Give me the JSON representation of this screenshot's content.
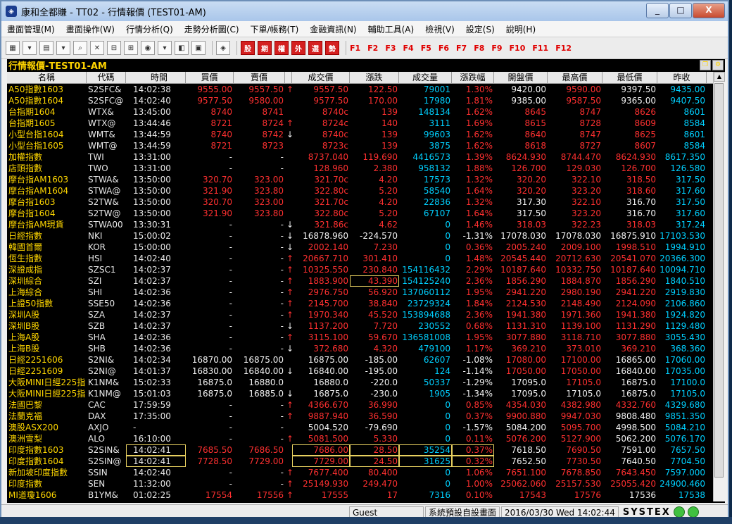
{
  "window": {
    "title": "康和全都賺 - TT02 - 行情報價 (TEST01-AM)",
    "min": "_",
    "max": "□",
    "close": "X"
  },
  "menu": [
    "畫面管理(M)",
    "畫面操作(W)",
    "行情分析(Q)",
    "走勢分析圖(C)",
    "下單/帳務(T)",
    "金融資訊(N)",
    "輔助工具(A)",
    "檢視(V)",
    "設定(S)",
    "說明(H)"
  ],
  "toolbar": {
    "redbuttons": [
      "股",
      "期",
      "權",
      "外",
      "選",
      "勢"
    ],
    "fkeys": [
      "F1",
      "F2",
      "F3",
      "F4",
      "F5",
      "F6",
      "F7",
      "F8",
      "F9",
      "F10",
      "F11",
      "F12"
    ]
  },
  "panel": {
    "title": "行情報價-TEST01-AM"
  },
  "columns": [
    "名稱",
    "代碼",
    "時間",
    "買價",
    "賣價",
    "",
    "成交價",
    "漲跌",
    "成交量",
    "漲跌幅",
    "開盤價",
    "最高價",
    "最低價",
    "昨收"
  ],
  "rows": [
    [
      "A50指數1603",
      "S2SFC&",
      "14:02:38",
      "9555.00",
      "9557.50",
      "↑",
      "9557.50",
      "122.50",
      "79001",
      "1.30%",
      "9420.00",
      "9590.00",
      "9397.50",
      "9435.00"
    ],
    [
      "A50指數1604",
      "S2SFC@",
      "14:02:40",
      "9577.50",
      "9580.00",
      "",
      "9577.50",
      "170.00",
      "17980",
      "1.81%",
      "9385.00",
      "9587.50",
      "9365.00",
      "9407.50"
    ],
    [
      "台指期1604",
      "WTX&",
      "13:45:00",
      "8740",
      "8741",
      "",
      "8740c",
      "139",
      "148134",
      "1.62%",
      "8645",
      "8747",
      "8626",
      "8601"
    ],
    [
      "台指期1605",
      "WTX@",
      "13:44:46",
      "8721",
      "8724",
      "↑",
      "8724c",
      "140",
      "3111",
      "1.69%",
      "8615",
      "8728",
      "8609",
      "8584"
    ],
    [
      "小型台指1604",
      "WMT&",
      "13:44:59",
      "8740",
      "8742",
      "↓",
      "8740c",
      "139",
      "99603",
      "1.62%",
      "8640",
      "8747",
      "8625",
      "8601"
    ],
    [
      "小型台指1605",
      "WMT@",
      "13:44:59",
      "8721",
      "8723",
      "",
      "8723c",
      "139",
      "3875",
      "1.62%",
      "8618",
      "8727",
      "8607",
      "8584"
    ],
    [
      "加權指數",
      "TWI",
      "13:31:00",
      "-",
      "-",
      "",
      "8737.040",
      "119.690",
      "4416573",
      "1.39%",
      "8624.930",
      "8744.470",
      "8624.930",
      "8617.350"
    ],
    [
      "店頭指數",
      "TWO",
      "13:31:00",
      "-",
      "-",
      "",
      "128.960",
      "2.380",
      "958132",
      "1.88%",
      "126.700",
      "129.030",
      "126.700",
      "126.580"
    ],
    [
      "摩台指AM1603",
      "STWA&",
      "13:50:00",
      "320.70",
      "323.00",
      "",
      "321.70c",
      "4.20",
      "17573",
      "1.32%",
      "320.20",
      "322.10",
      "318.50",
      "317.50"
    ],
    [
      "摩台指AM1604",
      "STWA@",
      "13:50:00",
      "321.90",
      "323.80",
      "",
      "322.80c",
      "5.20",
      "58540",
      "1.64%",
      "320.20",
      "323.20",
      "318.60",
      "317.60"
    ],
    [
      "摩台指1603",
      "S2TW&",
      "13:50:00",
      "320.70",
      "323.00",
      "",
      "321.70c",
      "4.20",
      "22836",
      "1.32%",
      "317.30",
      "322.10",
      "316.70",
      "317.50"
    ],
    [
      "摩台指1604",
      "S2TW@",
      "13:50:00",
      "321.90",
      "323.80",
      "",
      "322.80c",
      "5.20",
      "67107",
      "1.64%",
      "317.50",
      "323.20",
      "316.70",
      "317.60"
    ],
    [
      "摩台指AM現貨",
      "STWA00",
      "13:30:31",
      "-",
      "-",
      "↓",
      "321.86c",
      "4.62",
      "0",
      "1.46%",
      "318.03",
      "322.23",
      "318.03",
      "317.24"
    ],
    [
      "日經指數",
      "NKI",
      "15:00:02",
      "-",
      "-",
      "↓",
      "16878.960",
      "-224.570",
      "0",
      "-1.31%",
      "17078.030",
      "17078.030",
      "16875.910",
      "17103.530"
    ],
    [
      "韓國首爾",
      "KOR",
      "15:00:00",
      "-",
      "-",
      "↓",
      "2002.140",
      "7.230",
      "0",
      "0.36%",
      "2005.240",
      "2009.100",
      "1998.510",
      "1994.910"
    ],
    [
      "恆生指數",
      "HSI",
      "14:02:40",
      "-",
      "-",
      "↑",
      "20667.710",
      "301.410",
      "0",
      "1.48%",
      "20545.440",
      "20712.630",
      "20541.070",
      "20366.300"
    ],
    [
      "深證成指",
      "SZSC1",
      "14:02:37",
      "-",
      "-",
      "↑",
      "10325.550",
      "230.840",
      "154116432",
      "2.29%",
      "10187.640",
      "10332.750",
      "10187.640",
      "10094.710"
    ],
    [
      "深圳綜合",
      "SZI",
      "14:02:37",
      "-",
      "-",
      "↑",
      "1883.900",
      "43.390",
      "154125240",
      "2.36%",
      "1856.290",
      "1884.870",
      "1856.290",
      "1840.510"
    ],
    [
      "上海綜合",
      "SHI",
      "14:02:36",
      "-",
      "-",
      "↑",
      "2976.750",
      "56.920",
      "137060112",
      "1.95%",
      "2941.220",
      "2980.190",
      "2941.220",
      "2919.830"
    ],
    [
      "上證50指數",
      "SSE50",
      "14:02:36",
      "-",
      "-",
      "↑",
      "2145.700",
      "38.840",
      "23729324",
      "1.84%",
      "2124.530",
      "2148.490",
      "2124.090",
      "2106.860"
    ],
    [
      "深圳A股",
      "SZA",
      "14:02:37",
      "-",
      "-",
      "↑",
      "1970.340",
      "45.520",
      "153894688",
      "2.36%",
      "1941.380",
      "1971.360",
      "1941.380",
      "1924.820"
    ],
    [
      "深圳B股",
      "SZB",
      "14:02:37",
      "-",
      "-",
      "↓",
      "1137.200",
      "7.720",
      "230552",
      "0.68%",
      "1131.310",
      "1139.100",
      "1131.290",
      "1129.480"
    ],
    [
      "上海A股",
      "SHA",
      "14:02:36",
      "-",
      "-",
      "↑",
      "3115.100",
      "59.670",
      "136581008",
      "1.95%",
      "3077.880",
      "3118.710",
      "3077.880",
      "3055.430"
    ],
    [
      "上海B股",
      "SHB",
      "14:02:36",
      "-",
      "-",
      "↓",
      "372.680",
      "4.320",
      "479100",
      "1.17%",
      "369.210",
      "373.010",
      "369.210",
      "368.360"
    ],
    [
      "日經2251606",
      "S2NI&",
      "14:02:34",
      "16870.00",
      "16875.00",
      "",
      "16875.00",
      "-185.00",
      "62607",
      "-1.08%",
      "17080.00",
      "17100.00",
      "16865.00",
      "17060.00"
    ],
    [
      "日經2251609",
      "S2NI@",
      "14:01:37",
      "16830.00",
      "16840.00",
      "↓",
      "16840.00",
      "-195.00",
      "124",
      "-1.14%",
      "17050.00",
      "17050.00",
      "16840.00",
      "17035.00"
    ],
    [
      "大阪MINI日經225指",
      "K1NM&",
      "15:02:33",
      "16875.0",
      "16880.0",
      "",
      "16880.0",
      "-220.0",
      "50337",
      "-1.29%",
      "17095.0",
      "17105.0",
      "16875.0",
      "17100.0"
    ],
    [
      "大阪MINI日經225指",
      "K1NM@",
      "15:01:03",
      "16875.0",
      "16885.0",
      "↓",
      "16875.0",
      "-230.0",
      "1905",
      "-1.34%",
      "17095.0",
      "17105.0",
      "16875.0",
      "17105.0"
    ],
    [
      "法國巴黎",
      "CAC",
      "17:59:59",
      "-",
      "-",
      "↑",
      "4366.670",
      "36.990",
      "0",
      "0.85%",
      "4354.030",
      "4382.980",
      "4332.760",
      "4329.680"
    ],
    [
      "法蘭克福",
      "DAX",
      "17:35:00",
      "-",
      "-",
      "↑",
      "9887.940",
      "36.590",
      "0",
      "0.37%",
      "9900.880",
      "9947.030",
      "9808.480",
      "9851.350"
    ],
    [
      "澳股ASX200",
      "AXJO",
      "-",
      "-",
      "-",
      "",
      "5004.520",
      "-79.690",
      "0",
      "-1.57%",
      "5084.200",
      "5095.700",
      "4998.500",
      "5084.210"
    ],
    [
      "澳洲雪梨",
      "ALO",
      "16:10:00",
      "-",
      "-",
      "↑",
      "5081.500",
      "5.330",
      "0",
      "0.11%",
      "5076.200",
      "5127.900",
      "5062.200",
      "5076.170"
    ],
    [
      "印度指數1603",
      "S2SIN&",
      "14:02:41",
      "7685.50",
      "7686.50",
      "",
      "7686.00",
      "28.50",
      "35254",
      "0.37%",
      "7618.50",
      "7690.50",
      "7591.00",
      "7657.50"
    ],
    [
      "印度指數1604",
      "S2SIN@",
      "14:02:41",
      "7728.50",
      "7729.00",
      "",
      "7729.00",
      "24.50",
      "31625",
      "0.32%",
      "7652.50",
      "7730.50",
      "7640.50",
      "7704.50"
    ],
    [
      "新加坡印度指數",
      "SSIN",
      "14:02:40",
      "-",
      "-",
      "↑",
      "7677.400",
      "80.400",
      "0",
      "1.06%",
      "7651.100",
      "7678.850",
      "7643.450",
      "7597.000"
    ],
    [
      "印度指數",
      "SEN",
      "11:32:00",
      "-",
      "-",
      "↑",
      "25149.930",
      "249.470",
      "0",
      "1.00%",
      "25062.060",
      "25157.530",
      "25055.420",
      "24900.460"
    ],
    [
      "MI道瓊1606",
      "B1YM&",
      "01:02:25",
      "17554",
      "17556",
      "↑",
      "17555",
      "17",
      "7316",
      "0.10%",
      "17543",
      "17576",
      "17536",
      "17538"
    ]
  ],
  "colors": {
    "up": "#ff3030",
    "down": "#f2f2f2",
    "volume": "#00d0ff",
    "name": "#ffd700"
  },
  "status": {
    "user": "Guest",
    "screen": "系統預設自設畫面",
    "datetime": "2016/03/30 Wed 14:02:44",
    "brand": "SYSTEX"
  }
}
